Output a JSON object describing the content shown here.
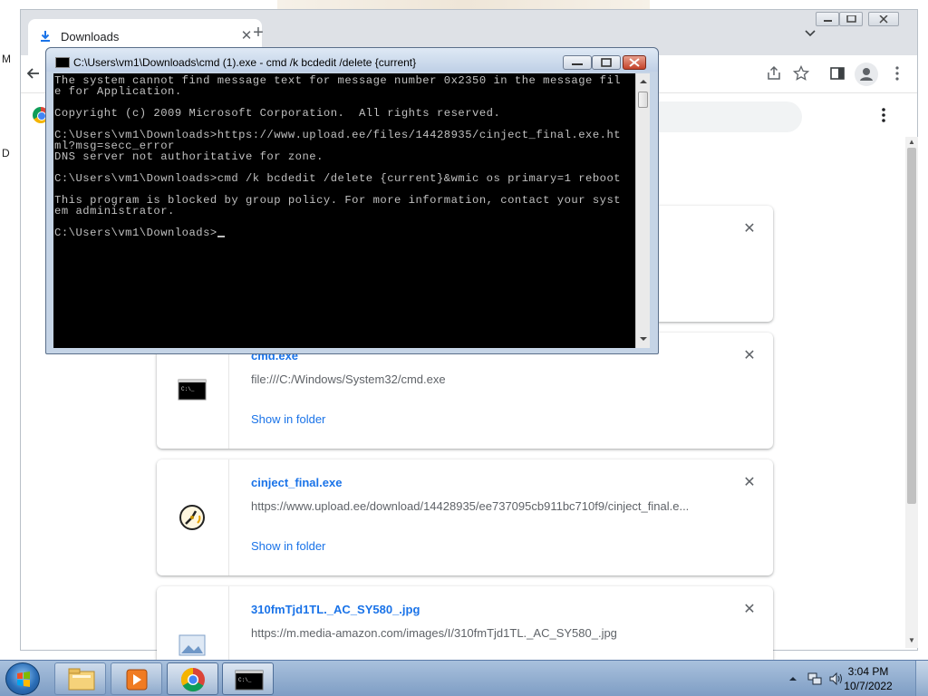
{
  "desktop": {
    "left_letters": [
      "M",
      "D"
    ]
  },
  "browser": {
    "tab": {
      "title": "Downloads",
      "icon": "download-icon",
      "close_icon": "close-icon"
    },
    "new_tab_icon": "plus-icon",
    "downloads": [
      {
        "name": "",
        "url": "",
        "action": ""
      },
      {
        "name": "cmd.exe",
        "url": "file:///C:/Windows/System32/cmd.exe",
        "action": "Show in folder",
        "icon": "cmd-file-icon"
      },
      {
        "name": "cinject_final.exe",
        "url": "https://www.upload.ee/download/14428935/ee737095cb911bc710f9/cinject_final.e...",
        "action": "Show in folder",
        "icon": "exe-app-icon"
      },
      {
        "name": "310fmTjd1TL._AC_SY580_.jpg",
        "url": "https://m.media-amazon.com/images/I/310fmTjd1TL._AC_SY580_.jpg",
        "action": "",
        "icon": "image-file-icon"
      }
    ]
  },
  "cmd": {
    "title": "C:\\Users\\vm1\\Downloads\\cmd (1).exe - cmd  /k bcdedit /delete {current}",
    "lines": [
      "The system cannot find message text for message number 0x2350 in the message fil",
      "e for Application.",
      "",
      "Copyright (c) 2009 Microsoft Corporation.  All rights reserved.",
      "",
      "C:\\Users\\vm1\\Downloads>https://www.upload.ee/files/14428935/cinject_final.exe.ht",
      "ml?msg=secc_error",
      "DNS server not authoritative for zone.",
      "",
      "C:\\Users\\vm1\\Downloads>cmd /k bcdedit /delete {current}&wmic os primary=1 reboot",
      "",
      "This program is blocked by group policy. For more information, contact your syst",
      "em administrator.",
      "",
      "C:\\Users\\vm1\\Downloads>"
    ]
  },
  "taskbar": {
    "items": [
      "explorer-icon",
      "media-player-icon",
      "chrome-icon",
      "cmd-icon"
    ],
    "time": "3:04 PM",
    "date": "10/7/2022"
  },
  "colors": {
    "link": "#1a73e8",
    "taskbar": "#8fa9cd",
    "console_bg": "#000000",
    "console_fg": "#c0c0c0"
  }
}
